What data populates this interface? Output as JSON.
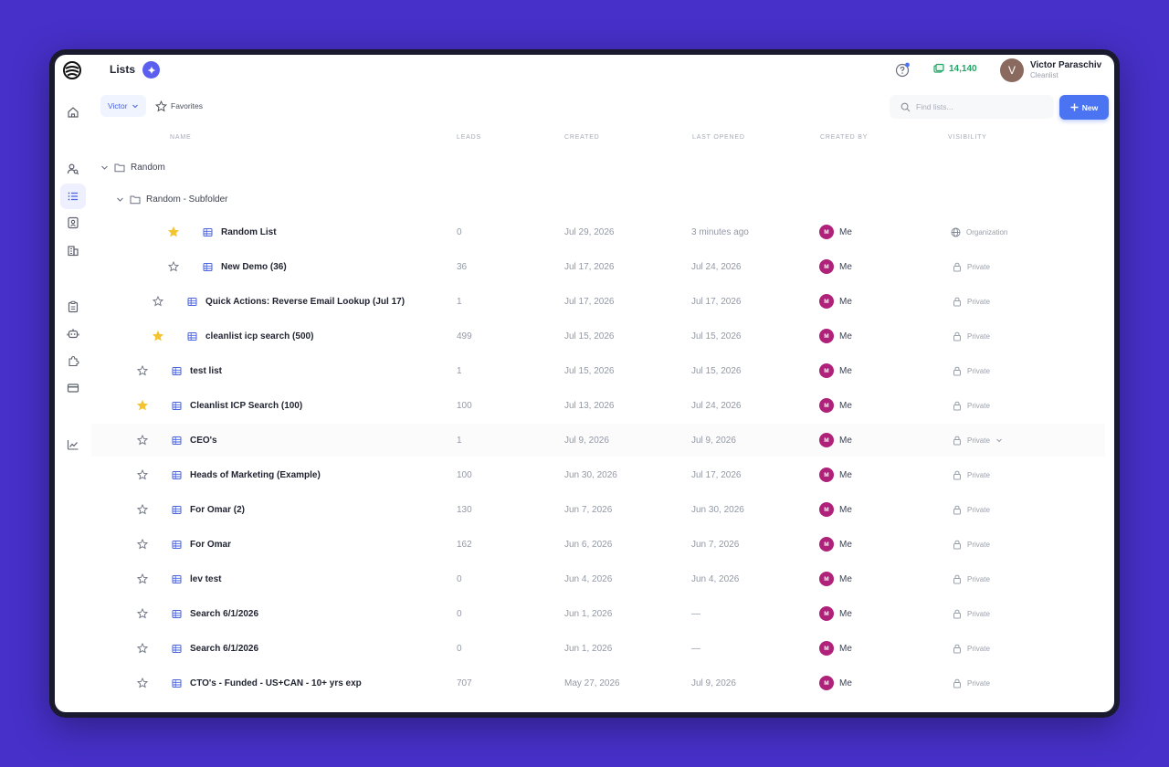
{
  "header": {
    "title": "Lists",
    "credits": "14,140",
    "user": {
      "initial": "V",
      "name": "Victor Paraschiv",
      "org": "Cleanlist"
    }
  },
  "filters": {
    "owner": "Victor",
    "favorites": "Favorites",
    "search_placeholder": "Find lists...",
    "new_label": "New"
  },
  "columns": {
    "name": "Name",
    "leads": "Leads",
    "created": "Created",
    "last_opened": "Last opened",
    "created_by": "Created by",
    "visibility": "Visibility"
  },
  "folders": [
    {
      "name": "Random"
    },
    {
      "name": "Random - Subfolder"
    }
  ],
  "rows": [
    {
      "name": "Random List",
      "leads": "0",
      "created": "Jul 29, 2026",
      "last_opened": "3 minutes ago",
      "created_by": "Me",
      "visibility": "Organization",
      "starred": true
    },
    {
      "name": "New Demo (36)",
      "leads": "36",
      "created": "Jul 17, 2026",
      "last_opened": "Jul 24, 2026",
      "created_by": "Me",
      "visibility": "Private",
      "starred": false
    },
    {
      "name": "Quick Actions: Reverse Email Lookup (Jul 17)",
      "leads": "1",
      "created": "Jul 17, 2026",
      "last_opened": "Jul 17, 2026",
      "created_by": "Me",
      "visibility": "Private",
      "starred": false
    },
    {
      "name": "cleanlist icp search (500)",
      "leads": "499",
      "created": "Jul 15, 2026",
      "last_opened": "Jul 15, 2026",
      "created_by": "Me",
      "visibility": "Private",
      "starred": true
    },
    {
      "name": "test list",
      "leads": "1",
      "created": "Jul 15, 2026",
      "last_opened": "Jul 15, 2026",
      "created_by": "Me",
      "visibility": "Private",
      "starred": false
    },
    {
      "name": "Cleanlist ICP Search (100)",
      "leads": "100",
      "created": "Jul 13, 2026",
      "last_opened": "Jul 24, 2026",
      "created_by": "Me",
      "visibility": "Private",
      "starred": true
    },
    {
      "name": "CEO's",
      "leads": "1",
      "created": "Jul 9, 2026",
      "last_opened": "Jul 9, 2026",
      "created_by": "Me",
      "visibility": "Private",
      "starred": false
    },
    {
      "name": "Heads of Marketing (Example)",
      "leads": "100",
      "created": "Jun 30, 2026",
      "last_opened": "Jul 17, 2026",
      "created_by": "Me",
      "visibility": "Private",
      "starred": false
    },
    {
      "name": "For Omar (2)",
      "leads": "130",
      "created": "Jun 7, 2026",
      "last_opened": "Jun 30, 2026",
      "created_by": "Me",
      "visibility": "Private",
      "starred": false
    },
    {
      "name": "For Omar",
      "leads": "162",
      "created": "Jun 6, 2026",
      "last_opened": "Jun 7, 2026",
      "created_by": "Me",
      "visibility": "Private",
      "starred": false
    },
    {
      "name": "lev test",
      "leads": "0",
      "created": "Jun 4, 2026",
      "last_opened": "Jun 4, 2026",
      "created_by": "Me",
      "visibility": "Private",
      "starred": false
    },
    {
      "name": "Search 6/1/2026",
      "leads": "0",
      "created": "Jun 1, 2026",
      "last_opened": "—",
      "created_by": "Me",
      "visibility": "Private",
      "starred": false
    },
    {
      "name": "Search 6/1/2026",
      "leads": "0",
      "created": "Jun 1, 2026",
      "last_opened": "—",
      "created_by": "Me",
      "visibility": "Private",
      "starred": false
    },
    {
      "name": "CTO's - Funded - US+CAN - 10+ yrs exp",
      "leads": "707",
      "created": "May 27, 2026",
      "last_opened": "Jul 9, 2026",
      "created_by": "Me",
      "visibility": "Private",
      "starred": false
    }
  ],
  "colors": {
    "accent": "#4a74f2",
    "star": "#f4c430",
    "avatar_me": "#b0217a",
    "credits": "#21a466"
  }
}
